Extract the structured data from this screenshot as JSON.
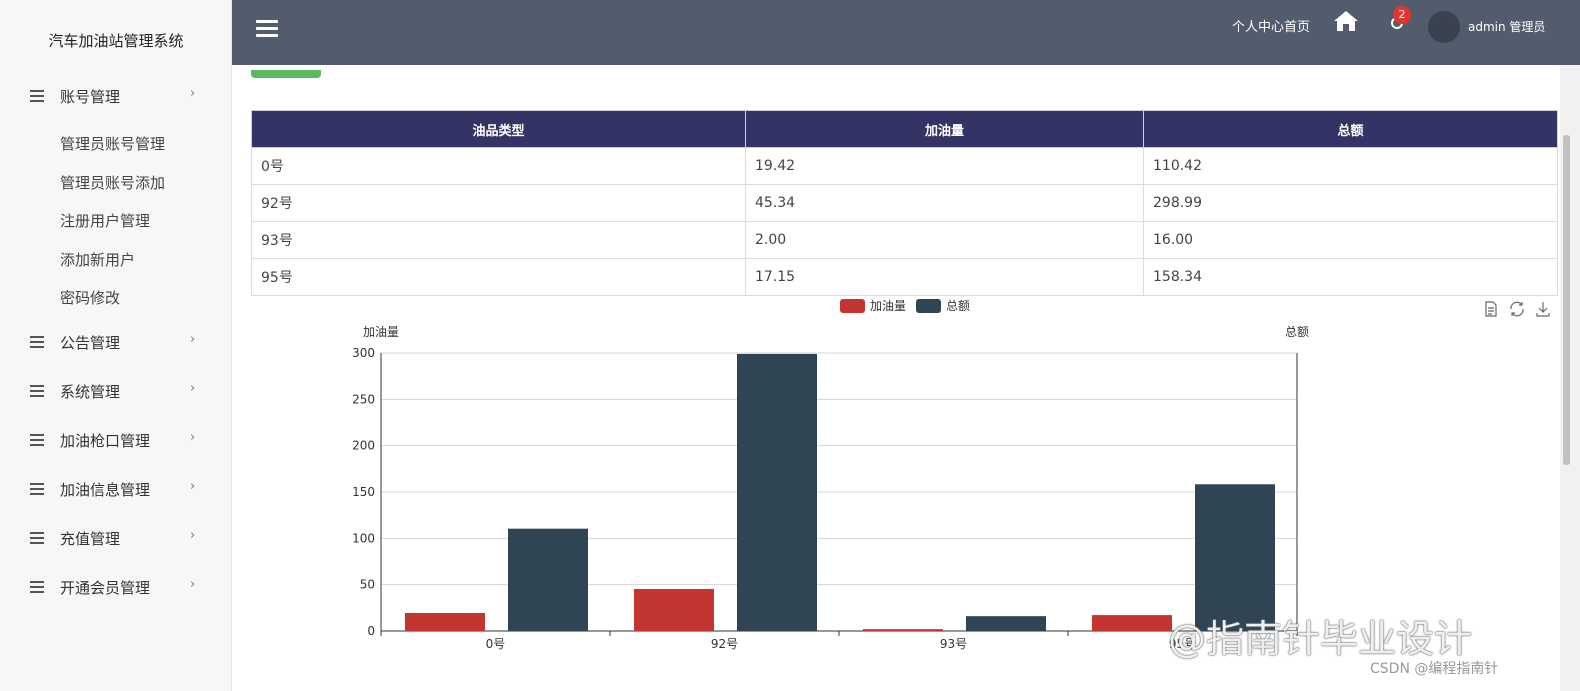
{
  "app": {
    "title": "汽车加油站管理系统"
  },
  "sidebar": {
    "groups": [
      {
        "label": "账号管理",
        "chevron": "›"
      },
      {
        "label": "公告管理",
        "chevron": "›"
      },
      {
        "label": "系统管理",
        "chevron": "›"
      },
      {
        "label": "加油枪口管理",
        "chevron": "›"
      },
      {
        "label": "加油信息管理",
        "chevron": "›"
      },
      {
        "label": "充值管理",
        "chevron": "›"
      },
      {
        "label": "开通会员管理",
        "chevron": "›"
      }
    ],
    "sub_items": [
      "管理员账号管理",
      "管理员账号添加",
      "注册用户管理",
      "添加新用户",
      "密码修改"
    ]
  },
  "header": {
    "home_link": "个人中心首页",
    "notification_count": "2",
    "username": "admin 管理员",
    "icons": [
      "menu-icon",
      "home-icon",
      "refresh-icon",
      "avatar"
    ]
  },
  "table": {
    "headers": [
      "油品类型",
      "加油量",
      "总额"
    ],
    "rows": [
      [
        "0号",
        "19.42",
        "110.42"
      ],
      [
        "92号",
        "45.34",
        "298.99"
      ],
      [
        "93号",
        "2.00",
        "16.00"
      ],
      [
        "95号",
        "17.15",
        "158.34"
      ]
    ]
  },
  "chart_data": {
    "type": "bar",
    "categories": [
      "0号",
      "92号",
      "93号",
      "95号"
    ],
    "series": [
      {
        "name": "加油量",
        "values": [
          19.42,
          45.34,
          2.0,
          17.15
        ],
        "color": "#c23531"
      },
      {
        "name": "总额",
        "values": [
          110.42,
          298.99,
          16.0,
          158.34
        ],
        "color": "#2f4554"
      }
    ],
    "ylabel_left": "加油量",
    "ylabel_right": "总额",
    "ylim": [
      0,
      300
    ],
    "yticks": [
      0,
      50,
      100,
      150,
      200,
      250,
      300
    ],
    "legend": "top-center",
    "grid": true,
    "toolbox": [
      "data-view-icon",
      "restore-icon",
      "save-image-icon"
    ]
  },
  "watermark": {
    "text": "@指南针毕业设计",
    "source": "CSDN @编程指南针"
  },
  "colors": {
    "topbar": "#535c6c",
    "table_header": "#333366",
    "accent": "#5cb85c",
    "badge": "#e3342f"
  }
}
